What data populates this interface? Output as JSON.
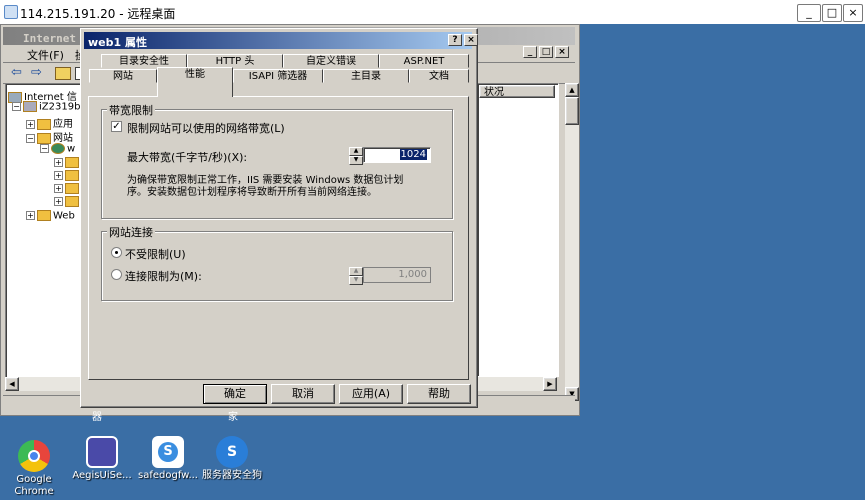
{
  "remote_desktop": {
    "title": "114.215.191.20 - 远程桌面",
    "buttons": [
      "_",
      "□",
      "×"
    ]
  },
  "iis_window": {
    "title": "Internet 信",
    "inner_close_buttons": [
      "_",
      "□",
      "×"
    ],
    "menu_file": "文件(F)",
    "menu_action": "操",
    "list_header_status": "状况",
    "tree": {
      "root": "Internet 信",
      "server": "iZ2319b",
      "item1": "应用",
      "item2": "网站",
      "item3": "w",
      "item_web": "Web"
    },
    "taskbar_fragments": [
      "器",
      "家"
    ]
  },
  "dialog": {
    "title": "web1 属性",
    "title_buttons": [
      "?",
      "×"
    ],
    "tabs_row1": [
      "目录安全性",
      "HTTP 头",
      "自定义错误",
      "ASP.NET"
    ],
    "tabs_row2": [
      "网站",
      "性能",
      "ISAPI 筛选器",
      "主目录",
      "文档"
    ],
    "active_tab": "性能",
    "bandwidth": {
      "group_label": "带宽限制",
      "checkbox_label": "限制网站可以使用的网络带宽(L)",
      "checked": true,
      "max_label": "最大带宽(千字节/秒)(X):",
      "max_value": "1024",
      "note_line1": "为确保带宽限制正常工作，IIS 需要安装 Windows 数据包计划",
      "note_line2": "序。安装数据包计划程序将导致断开所有当前网络连接。"
    },
    "connections": {
      "group_label": "网站连接",
      "radio_unlimited": "不受限制(U)",
      "radio_limited": "连接限制为(M):",
      "selected": "unlimited",
      "limit_value": "1,000"
    },
    "buttons": {
      "ok": "确定",
      "cancel": "取消",
      "apply": "应用(A)",
      "help": "帮助"
    }
  },
  "desktop_icons": [
    {
      "label": "Google Chrome",
      "icon": "chrome-icon",
      "color": "#e8453c"
    },
    {
      "label": "AegisUiSe...",
      "icon": "shield-icon",
      "color": "#4a4aa8"
    },
    {
      "label": "safedogfw...",
      "icon": "safedog-icon",
      "color": "#3a8ee0"
    },
    {
      "label": "服务器安全狗",
      "icon": "safedog-icon",
      "color": "#2a7ed8"
    }
  ]
}
